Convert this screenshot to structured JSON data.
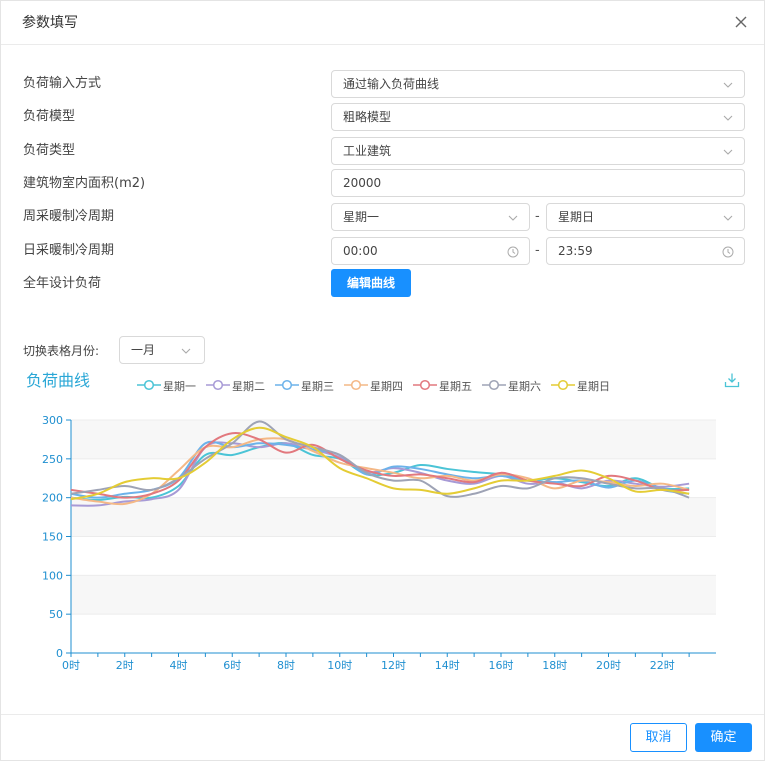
{
  "dialog": {
    "title": "参数填写"
  },
  "form": {
    "load_input_mode": {
      "label": "负荷输入方式",
      "value": "通过输入负荷曲线"
    },
    "load_model": {
      "label": "负荷模型",
      "value": "粗略模型"
    },
    "load_type": {
      "label": "负荷类型",
      "value": "工业建筑"
    },
    "floor_area": {
      "label": "建筑物室内面积(m2)",
      "value": "20000"
    },
    "weekly_period": {
      "label": "周采暖制冷周期",
      "start": "星期一",
      "separator": "-",
      "end": "星期日"
    },
    "daily_period": {
      "label": "日采暖制冷周期",
      "start": "00:00",
      "separator": "-",
      "end": "23:59"
    },
    "annual_load": {
      "label": "全年设计负荷",
      "button": "编辑曲线"
    }
  },
  "month_switch": {
    "label": "切换表格月份:",
    "value": "一月"
  },
  "chart_header": {
    "title": "负荷曲线"
  },
  "icons": {
    "close": "close-icon",
    "download": "download-icon",
    "chevron": "chevron-down-icon",
    "clock": "clock-icon"
  },
  "colors": {
    "accent": "#1890ff",
    "title": "#2aa7d6",
    "axis": "#1f8fd0"
  },
  "chart_data": {
    "type": "line",
    "x": [
      "0时",
      "1时",
      "2时",
      "3时",
      "4时",
      "5时",
      "6时",
      "7时",
      "8时",
      "9时",
      "10时",
      "11时",
      "12时",
      "13时",
      "14时",
      "15时",
      "16时",
      "17时",
      "18时",
      "19时",
      "20时",
      "21时",
      "22时",
      "23时"
    ],
    "x_tick_labels": [
      "0时",
      "2时",
      "4时",
      "6时",
      "8时",
      "10时",
      "12时",
      "14时",
      "16时",
      "18时",
      "20时",
      "22时"
    ],
    "ylim": [
      0,
      300
    ],
    "y_ticks": [
      0,
      50,
      100,
      150,
      200,
      250,
      300
    ],
    "grid": true,
    "legend_position": "top",
    "series": [
      {
        "name": "星期一",
        "color": "#4bc4d6",
        "values": [
          200,
          197,
          201,
          200,
          215,
          255,
          255,
          265,
          270,
          255,
          250,
          230,
          232,
          242,
          237,
          233,
          230,
          222,
          225,
          220,
          215,
          225,
          212,
          212
        ]
      },
      {
        "name": "星期二",
        "color": "#a79ad6",
        "values": [
          190,
          190,
          195,
          198,
          210,
          265,
          270,
          265,
          270,
          262,
          252,
          233,
          238,
          232,
          222,
          218,
          228,
          218,
          220,
          212,
          222,
          218,
          214,
          218
        ]
      },
      {
        "name": "星期三",
        "color": "#6cb2ea",
        "values": [
          205,
          200,
          205,
          210,
          225,
          270,
          265,
          270,
          268,
          262,
          255,
          230,
          240,
          237,
          230,
          225,
          228,
          222,
          220,
          222,
          213,
          222,
          210,
          205
        ]
      },
      {
        "name": "星期四",
        "color": "#f4b886",
        "values": [
          200,
          195,
          192,
          205,
          235,
          265,
          265,
          275,
          275,
          260,
          245,
          238,
          232,
          225,
          228,
          222,
          230,
          225,
          212,
          222,
          220,
          215,
          218,
          210
        ]
      },
      {
        "name": "星期五",
        "color": "#e2787e",
        "values": [
          210,
          205,
          200,
          205,
          222,
          265,
          283,
          275,
          258,
          268,
          250,
          235,
          228,
          230,
          225,
          220,
          232,
          222,
          218,
          215,
          228,
          222,
          210,
          210
        ]
      },
      {
        "name": "星期六",
        "color": "#9ea3b5",
        "values": [
          205,
          210,
          215,
          210,
          225,
          250,
          270,
          298,
          275,
          265,
          255,
          232,
          222,
          222,
          202,
          205,
          215,
          212,
          225,
          225,
          218,
          212,
          212,
          200
        ]
      },
      {
        "name": "星期日",
        "color": "#e4cc34",
        "values": [
          198,
          205,
          220,
          225,
          225,
          245,
          275,
          290,
          278,
          265,
          238,
          225,
          212,
          210,
          205,
          212,
          222,
          222,
          228,
          235,
          225,
          208,
          210,
          205
        ]
      }
    ]
  }
}
